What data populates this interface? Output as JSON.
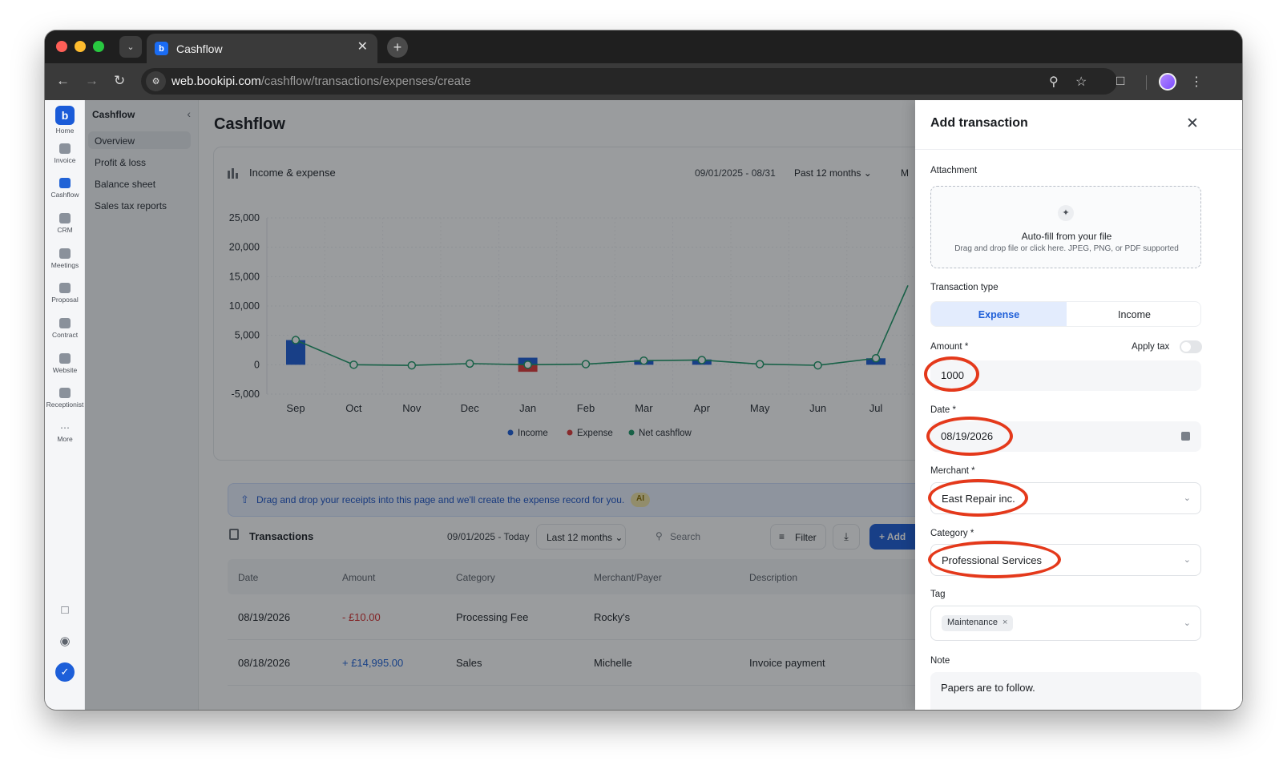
{
  "browser": {
    "tab_title": "Cashflow",
    "url_host": "web.bookipi.com",
    "url_path": "/cashflow/transactions/expenses/create"
  },
  "rail": {
    "items": [
      {
        "label": "Home"
      },
      {
        "label": "Invoice"
      },
      {
        "label": "Cashflow"
      },
      {
        "label": "CRM"
      },
      {
        "label": "Meetings"
      },
      {
        "label": "Proposal"
      },
      {
        "label": "Contract"
      },
      {
        "label": "Website"
      },
      {
        "label": "Receptionist"
      },
      {
        "label": "More"
      }
    ]
  },
  "subnav": {
    "title": "Cashflow",
    "items": [
      {
        "label": "Overview"
      },
      {
        "label": "Profit & loss"
      },
      {
        "label": "Balance sheet"
      },
      {
        "label": "Sales tax reports"
      }
    ]
  },
  "main": {
    "title": "Cashflow",
    "card": {
      "title": "Income & expense",
      "range": "09/01/2025 - 08/31",
      "period": "Past 12 months",
      "more": "M"
    },
    "ai_banner": {
      "text": "Drag and drop your receipts into this page and we'll create the expense record for you.",
      "chip": "AI"
    },
    "transactions": {
      "title": "Transactions",
      "range": "09/01/2025 - Today",
      "period": "Last 12 months",
      "search_placeholder": "Search",
      "filter_label": "Filter",
      "add_label": "Add",
      "columns": [
        "Date",
        "Amount",
        "Category",
        "Merchant/Payer",
        "Description"
      ],
      "rows": [
        {
          "date": "08/19/2026",
          "amount": "- £10.00",
          "category": "Processing Fee",
          "merchant": "Rocky's",
          "description": ""
        },
        {
          "date": "08/18/2026",
          "amount": "+ £14,995.00",
          "category": "Sales",
          "merchant": "Michelle",
          "description": "Invoice payment"
        }
      ]
    }
  },
  "chart_data": {
    "type": "line",
    "categories": [
      "Sep",
      "Oct",
      "Nov",
      "Dec",
      "Jan",
      "Feb",
      "Mar",
      "Apr",
      "May",
      "Jun",
      "Jul"
    ],
    "ylim": [
      -5000,
      25000
    ],
    "yticks": [
      "25,000",
      "20,000",
      "15,000",
      "10,000",
      "5,000",
      "0",
      "-5,000"
    ],
    "series": [
      {
        "name": "Income",
        "type": "bar",
        "color": "#1f5fd8",
        "values": [
          4200,
          0,
          0,
          0,
          1200,
          0,
          800,
          900,
          0,
          0,
          1100
        ]
      },
      {
        "name": "Expense",
        "type": "bar",
        "color": "#e03b3b",
        "values": [
          0,
          0,
          0,
          0,
          -1200,
          0,
          0,
          0,
          0,
          0,
          0
        ]
      },
      {
        "name": "Net cashflow",
        "type": "line",
        "color": "#1f9a6a",
        "values": [
          4200,
          0,
          -100,
          200,
          0,
          100,
          700,
          800,
          100,
          -100,
          1100
        ]
      }
    ],
    "legend": [
      "Income",
      "Expense",
      "Net cashflow"
    ],
    "legend_position": "bottom",
    "grid": true
  },
  "drawer": {
    "title": "Add transaction",
    "attachment_label": "Attachment",
    "dropzone_title": "Auto-fill from your file",
    "dropzone_sub": "Drag and drop file or click here. JPEG, PNG, or PDF supported",
    "transaction_type_label": "Transaction type",
    "type_expense": "Expense",
    "type_income": "Income",
    "amount_label": "Amount *",
    "amount_value": "1000",
    "apply_tax_label": "Apply tax",
    "date_label": "Date *",
    "date_value": "08/19/2026",
    "merchant_label": "Merchant *",
    "merchant_value": "East Repair inc.",
    "category_label": "Category *",
    "category_value": "Professional Services",
    "tag_label": "Tag",
    "tag_value": "Maintenance",
    "note_label": "Note",
    "note_value": "Papers are to follow."
  },
  "colors": {
    "accent": "#1f5fd8",
    "highlight_ring": "#e4391b"
  }
}
